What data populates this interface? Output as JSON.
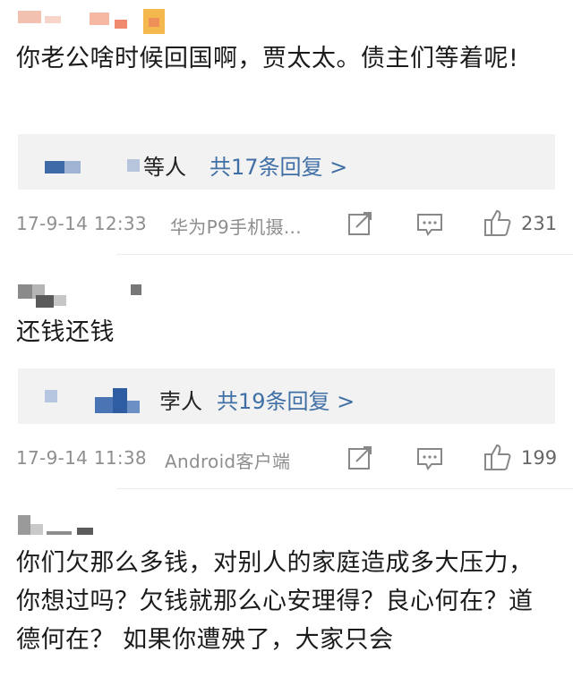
{
  "comments": [
    {
      "text": "你老公啥时候回国啊，贾太太。债主们等着呢!",
      "replies_prefix": "等人",
      "replies_link": "共17条回复 >",
      "timestamp": "17-9-14 12:33",
      "source": "华为P9手机摄...",
      "likes": "231"
    },
    {
      "text": "还钱还钱",
      "replies_prefix": "孛人",
      "replies_link": "共19条回复 >",
      "timestamp": "17-9-14 11:38",
      "source": "Android客户端",
      "likes": "199"
    },
    {
      "text": "你们欠那么多钱，对别人的家庭造成多大压力，你想过吗？欠钱就那么心安理得？良心何在？道德何在？ 如果你遭殃了，大家只会"
    }
  ],
  "icons": {
    "share": "share-icon",
    "reply": "comment-icon",
    "like": "thumbs-up-icon"
  },
  "colors": {
    "link": "#3f6fa5",
    "meta": "#8e8e8e",
    "reply_bg": "#f2f2f2"
  }
}
